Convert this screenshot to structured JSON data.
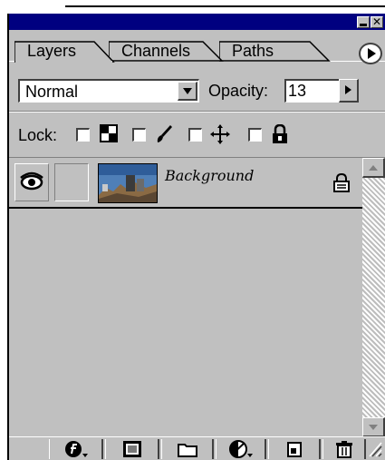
{
  "colors": {
    "title_bar": "#000080",
    "panel_face": "#c0c0c0",
    "shadow": "#404040"
  },
  "window": {
    "title_buttons": [
      "minimize-icon",
      "close-icon"
    ],
    "close_glyph": "✕"
  },
  "tabs": [
    {
      "label": "Layers",
      "active": true
    },
    {
      "label": "Channels",
      "active": false
    },
    {
      "label": "Paths",
      "active": false
    }
  ],
  "options": {
    "blend_mode": "Normal",
    "opacity_label": "Opacity:",
    "opacity_value": "13"
  },
  "lock": {
    "label": "Lock:",
    "icons": [
      "transparency-lock-icon",
      "brush-lock-icon",
      "move-lock-icon",
      "padlock-icon"
    ]
  },
  "layers": [
    {
      "name": "Background",
      "visible": true,
      "locked": true,
      "thumbnail_icon": "landscape-photo-thumbnail"
    }
  ],
  "toolbar_icons": [
    "layer-style-icon",
    "layer-mask-icon",
    "new-folder-icon",
    "adjustment-layer-icon",
    "new-layer-icon",
    "trash-icon"
  ]
}
